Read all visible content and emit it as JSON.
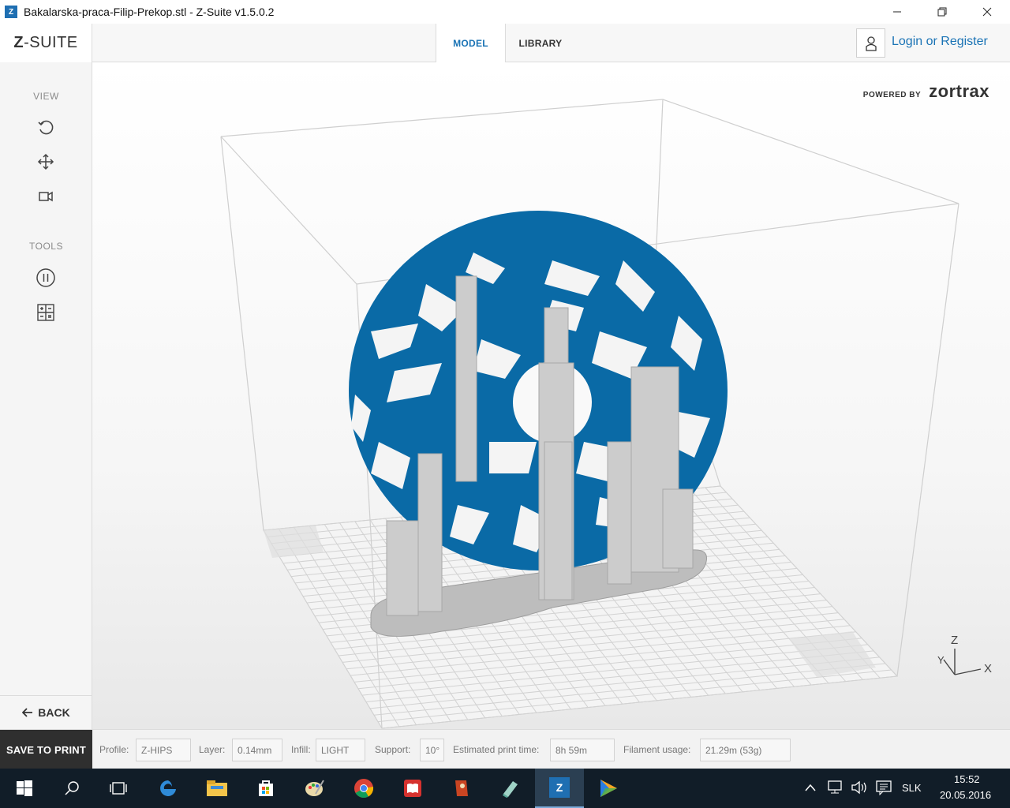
{
  "window": {
    "app_icon_letter": "Z",
    "title": "Bakalarska-praca-Filip-Prekop.stl - Z-Suite v1.5.0.2"
  },
  "header": {
    "logo_prefix": "Z",
    "logo_rest": "-SUITE",
    "tabs": [
      {
        "label": "MODEL",
        "active": true
      },
      {
        "label": "LIBRARY",
        "active": false
      }
    ],
    "login_label": "Login or Register"
  },
  "sidebar": {
    "view_label": "VIEW",
    "tools_label": "TOOLS",
    "view_icons": [
      "rotate-icon",
      "pan-icon",
      "camera-icon"
    ],
    "tool_icons": [
      "pause-icon",
      "calculator-icon"
    ],
    "back_label": "BACK"
  },
  "viewport": {
    "powered_by": "POWERED BY",
    "brand": "zortrax",
    "axis_labels": {
      "z": "Z",
      "y": "Y",
      "x": "X"
    },
    "model_color": "#0a6aa6",
    "support_color": "#c8c8c8"
  },
  "bottombar": {
    "save_label": "SAVE TO PRINT",
    "profile_label": "Profile:",
    "profile_value": "Z-HIPS",
    "layer_label": "Layer:",
    "layer_value": "0.14mm",
    "infill_label": "Infill:",
    "infill_value": "LIGHT",
    "support_label": "Support:",
    "support_value": "10°",
    "time_label": "Estimated print time:",
    "time_value": "8h 59m",
    "filament_label": "Filament usage:",
    "filament_value": "21.29m (53g)"
  },
  "taskbar": {
    "apps": [
      "start-icon",
      "search-icon",
      "task-view-icon",
      "edge-icon",
      "explorer-icon",
      "store-icon",
      "paint-icon",
      "chrome-icon",
      "reader-icon",
      "app-red-icon",
      "app-green-icon",
      "zsuite-icon",
      "media-icon"
    ],
    "language": "SLK",
    "time": "15:52",
    "date": "20.05.2016"
  }
}
